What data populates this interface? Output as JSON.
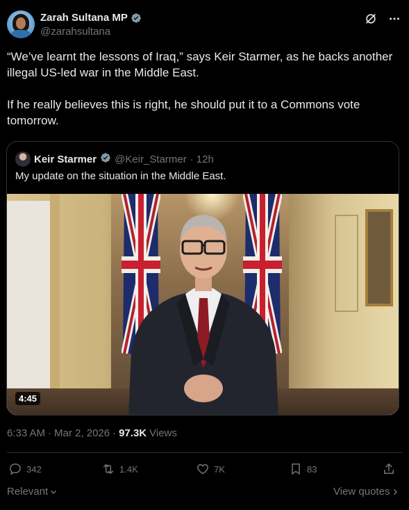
{
  "author": {
    "name": "Zarah Sultana MP",
    "handle": "@zarahsultana",
    "verified_badge_icon": "verified-badge-icon"
  },
  "header_icons": [
    "grok-icon",
    "more-icon"
  ],
  "tweet": {
    "paragraph1": "“We’ve learnt the lessons of Iraq,” says Keir Starmer, as he backs another illegal US-led war in the Middle East.",
    "paragraph2": "If he really believes this is right, he should put it to a Commons vote tomorrow."
  },
  "quoted": {
    "name": "Keir Starmer",
    "handle": "@Keir_Starmer",
    "time": "· 12h",
    "text": "My update on the situation in the Middle East.",
    "video_duration": "4:45"
  },
  "meta": {
    "time": "6:33 AM",
    "sep1": "·",
    "date": "Mar 2, 2026",
    "sep2": "·",
    "views_count": "97.3K",
    "views_label": "Views"
  },
  "actions": {
    "replies": "342",
    "reposts": "1.4K",
    "likes": "7K",
    "bookmarks": "83"
  },
  "footer": {
    "sort_label": "Relevant",
    "view_quotes": "View quotes"
  },
  "colors": {
    "background": "#000000",
    "text": "#e7e9ea",
    "secondary": "#71767b",
    "verified": "#829aab",
    "border": "#2f3336"
  }
}
